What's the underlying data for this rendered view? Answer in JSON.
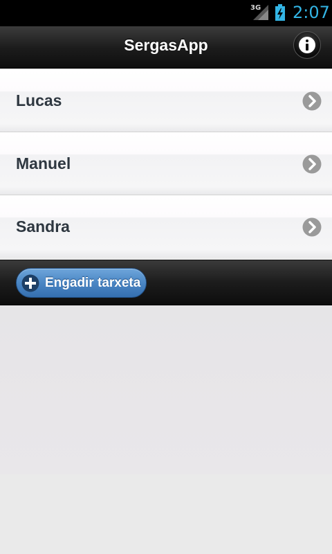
{
  "status_bar": {
    "network": "3G",
    "time": "2:07"
  },
  "header": {
    "title": "SergasApp",
    "info_icon": "info-icon"
  },
  "list": {
    "items": [
      {
        "label": "Lucas"
      },
      {
        "label": "Manuel"
      },
      {
        "label": "Sandra"
      }
    ],
    "chevron_icon": "chevron-right-icon"
  },
  "toolbar": {
    "add_button_label": "Engadir tarxeta",
    "add_icon": "plus-circle-icon"
  },
  "colors": {
    "status_accent": "#33b5e5",
    "button_blue": "#4a86c4",
    "text_dark": "#2e3740"
  }
}
